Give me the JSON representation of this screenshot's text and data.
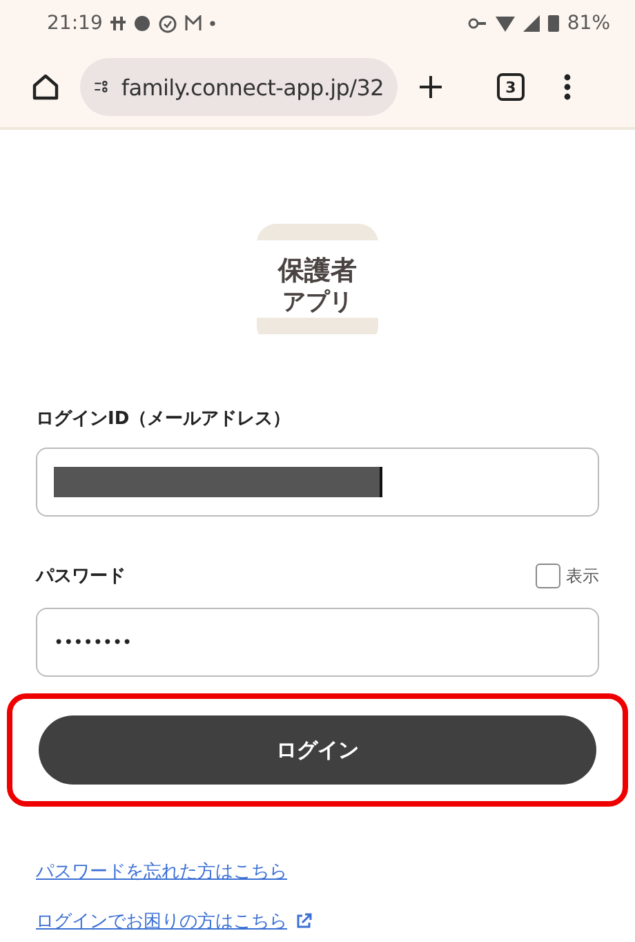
{
  "status_bar": {
    "time": "21:19",
    "battery": "81%"
  },
  "browser": {
    "url": "family.connect-app.jp/32",
    "tab_count": "3"
  },
  "logo": {
    "line_1": "保護者",
    "line_2": "アプリ"
  },
  "login_id": {
    "label": "ログインID（メールアドレス）",
    "redacted": true
  },
  "password": {
    "label": "パスワード",
    "value": "••••••••",
    "show_label": "表示",
    "show_checked": false
  },
  "login_button": {
    "label": "ログイン",
    "highlighted": true
  },
  "links": [
    {
      "text": "パスワードを忘れた方はこちら",
      "external": false
    },
    {
      "text": "ログインでお困りの方はこちら",
      "external": true
    }
  ]
}
